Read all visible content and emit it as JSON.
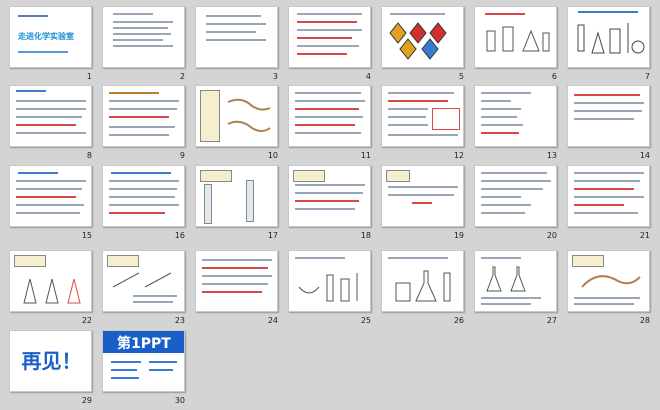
{
  "slides": [
    {
      "num": "1",
      "title": "走进化学实验室"
    },
    {
      "num": "2"
    },
    {
      "num": "3"
    },
    {
      "num": "4"
    },
    {
      "num": "5"
    },
    {
      "num": "6"
    },
    {
      "num": "7"
    },
    {
      "num": "8"
    },
    {
      "num": "9"
    },
    {
      "num": "10"
    },
    {
      "num": "11"
    },
    {
      "num": "12"
    },
    {
      "num": "13"
    },
    {
      "num": "14"
    },
    {
      "num": "15"
    },
    {
      "num": "16"
    },
    {
      "num": "17"
    },
    {
      "num": "18"
    },
    {
      "num": "19"
    },
    {
      "num": "20"
    },
    {
      "num": "21"
    },
    {
      "num": "22"
    },
    {
      "num": "23"
    },
    {
      "num": "24"
    },
    {
      "num": "25"
    },
    {
      "num": "26"
    },
    {
      "num": "27"
    },
    {
      "num": "28"
    },
    {
      "num": "29",
      "title": "再见！"
    },
    {
      "num": "30",
      "title": "第1PPT"
    }
  ],
  "colors": {
    "background": "#d4d4d4",
    "accent": "#1a5fc8",
    "red": "#d84848"
  }
}
